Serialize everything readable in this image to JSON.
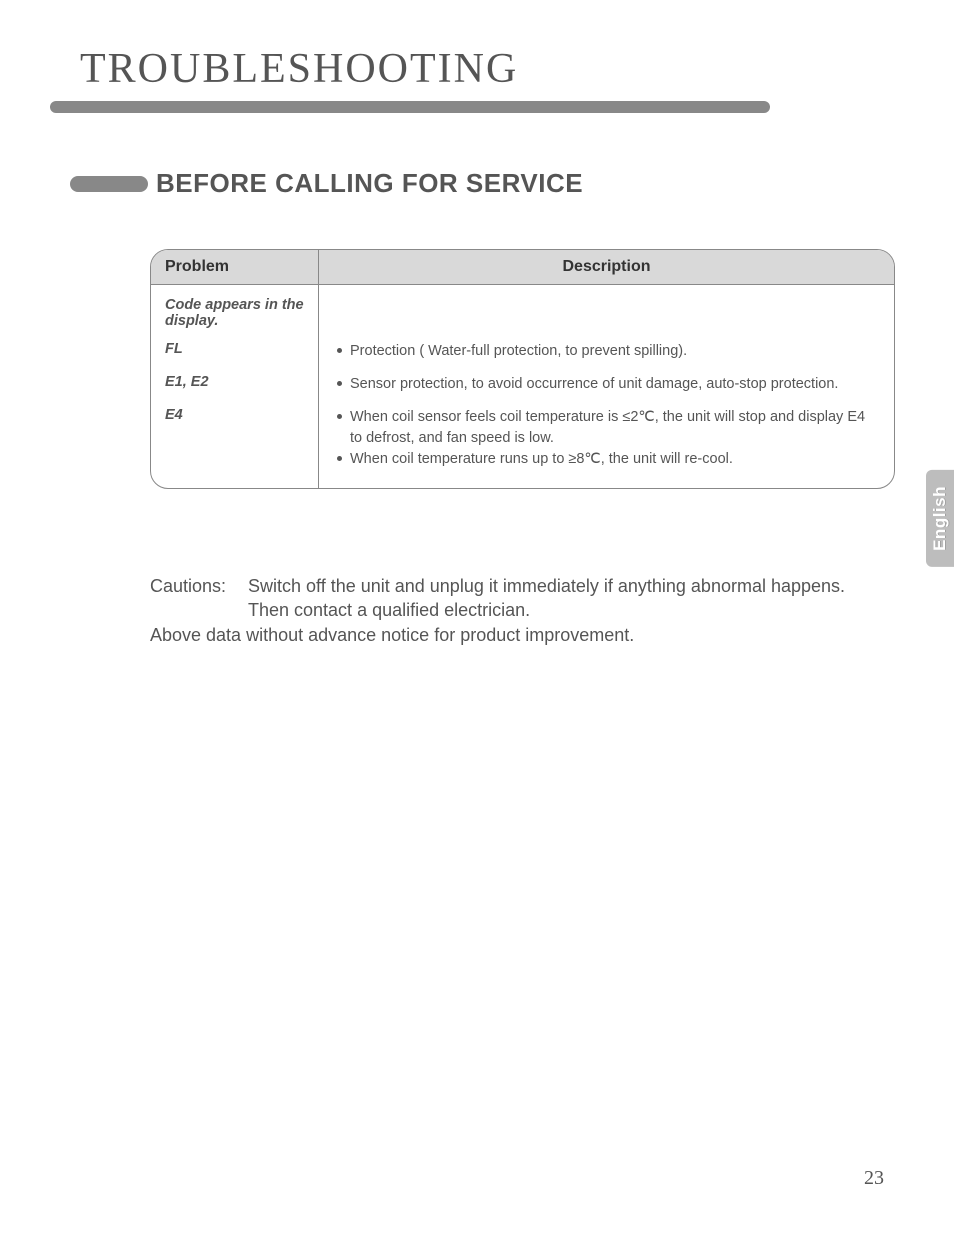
{
  "title": "TROUBLESHOOTING",
  "section_heading": "BEFORE CALLING FOR SERVICE",
  "side_tab": "English",
  "page_number": "23",
  "table": {
    "headers": {
      "problem": "Problem",
      "description": "Description"
    },
    "intro_problem": "Code appears in the display.",
    "rows": [
      {
        "problem": "FL",
        "descriptions": [
          "Protection ( Water-full protection, to prevent spilling)."
        ]
      },
      {
        "problem": "E1, E2",
        "descriptions": [
          "Sensor protection, to avoid occurrence of unit damage, auto-stop protection."
        ]
      },
      {
        "problem": "E4",
        "descriptions": [
          "When coil sensor feels coil temperature is ≤2℃, the unit will stop and display E4 to defrost, and fan speed is low.",
          "When coil temperature runs up to ≥8℃, the unit will re-cool."
        ]
      }
    ]
  },
  "cautions": {
    "label": "Cautions:",
    "body_line1": "Switch off the unit and unplug it immediately if anything abnormal happens.",
    "body_line2": "Then contact a qualified electrician.",
    "notice": "Above data without advance notice for product improvement."
  }
}
